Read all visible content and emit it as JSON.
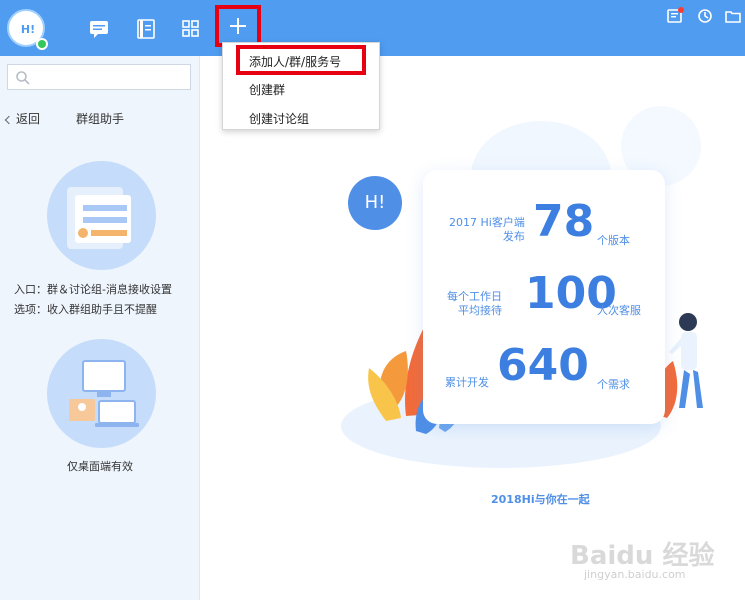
{
  "topbar": {
    "avatar_text": "H!",
    "icons": [
      "chat-icon",
      "contacts-icon",
      "apps-icon",
      "add-icon"
    ],
    "right_icons": [
      "notice-icon",
      "history-icon",
      "folder-icon"
    ]
  },
  "add_menu": {
    "items": [
      {
        "label": "添加人/群/服务号"
      },
      {
        "label": "创建群"
      },
      {
        "label": "创建讨论组"
      }
    ]
  },
  "sidebar": {
    "search": {
      "placeholder": ""
    },
    "back_label": "返回",
    "title": "群组助手",
    "note_line1": "入口：群＆讨论组-消息接收设置",
    "note_line2": "选项：收入群组助手且不提醒",
    "note_desktop": "仅桌面端有效"
  },
  "main": {
    "bubble_text": "H!",
    "stats": [
      {
        "label1": "2017 Hi客户端",
        "label2": "发布",
        "value": "78",
        "unit": "个版本"
      },
      {
        "label1": "每个工作日",
        "label2": "平均接待",
        "value": "100",
        "unit": "人次客服"
      },
      {
        "label1": "累计开发",
        "label2": "",
        "value": "640",
        "unit": "个需求"
      }
    ],
    "footer": "2018Hi与你在一起"
  },
  "watermark": {
    "line1": "Baidu 经验",
    "line2": "jingyan.baidu.com"
  },
  "colors": {
    "topbar": "#4f9cf0",
    "accent": "#3d7fe0",
    "highlight": "#e60012",
    "sidebar": "#eef5fd"
  }
}
